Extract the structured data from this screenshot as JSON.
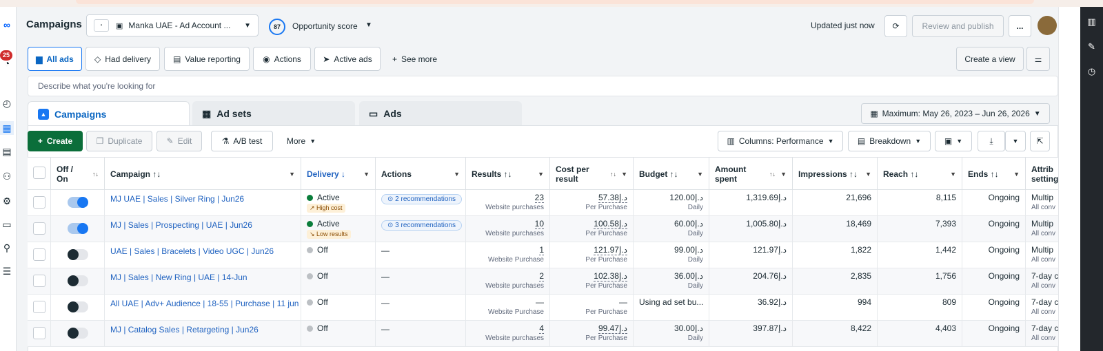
{
  "header": {
    "title": "Campaigns",
    "account": "Manka UAE - Ad Account ...",
    "opportunity_score": "87",
    "opportunity_label": "Opportunity score",
    "updated": "Updated just now",
    "review_publish": "Review and publish",
    "more": "...",
    "notif_count": "25"
  },
  "quickfilters": [
    "All ads",
    "Had delivery",
    "Value reporting",
    "Actions",
    "Active ads",
    "See more"
  ],
  "create_view": "Create a view",
  "filter_placeholder": "Describe what you're looking for",
  "tabs": [
    "Campaigns",
    "Ad sets",
    "Ads"
  ],
  "date_range": "Maximum: May 26, 2023 – Jun 26, 2026",
  "toolbar": {
    "create": "Create",
    "duplicate": "Duplicate",
    "edit": "Edit",
    "ab_test": "A/B test",
    "more": "More",
    "columns": "Columns: Performance",
    "breakdown": "Breakdown"
  },
  "columns": {
    "toggle": "Off / On",
    "campaign": "Campaign ↑↓",
    "delivery": "Delivery ↓",
    "actions": "Actions",
    "results": "Results ↑↓",
    "cost": "Cost per result",
    "cost_sort": "↑↓",
    "budget": "Budget ↑↓",
    "amount": "Amount spent",
    "amount_sort": "↑↓",
    "impressions": "Impressions ↑↓",
    "reach": "Reach ↑↓",
    "ends": "Ends ↑↓",
    "attrib": "Attrib setting"
  },
  "rows": [
    {
      "name": "MJ UAE | Sales | Silver Ring | Jun26",
      "on": true,
      "delivery": "Active",
      "chip": "↗ High cost",
      "action": "⊙ 2 recommendations",
      "results": "23",
      "results_sub": "Website purchases",
      "cost": "د.إ57.38",
      "cost_sub": "Per Purchase",
      "budget": "د.إ120.00",
      "budget_sub": "Daily",
      "amount": "د.إ1,319.69",
      "impressions": "21,696",
      "reach": "8,115",
      "ends": "Ongoing",
      "attrib": "Multip",
      "attrib_sub": "All conv"
    },
    {
      "name": "MJ | Sales | Prospecting | UAE | Jun26",
      "on": true,
      "delivery": "Active",
      "chip": "↘ Low results",
      "action": "⊙ 3 recommendations",
      "results": "10",
      "results_sub": "Website purchases",
      "cost": "د.إ100.58",
      "cost_sub": "Per Purchase",
      "budget": "د.إ60.00",
      "budget_sub": "Daily",
      "amount": "د.إ1,005.80",
      "impressions": "18,469",
      "reach": "7,393",
      "ends": "Ongoing",
      "attrib": "Multip",
      "attrib_sub": "All conv"
    },
    {
      "name": "UAE | Sales | Bracelets | Video UGC | Jun26",
      "on": false,
      "delivery": "Off",
      "chip": "",
      "action": "—",
      "results": "1",
      "results_sub": "Website Purchase",
      "cost": "د.إ121.97",
      "cost_sub": "Per Purchase",
      "budget": "د.إ99.00",
      "budget_sub": "Daily",
      "amount": "د.إ121.97",
      "impressions": "1,822",
      "reach": "1,442",
      "ends": "Ongoing",
      "attrib": "Multip",
      "attrib_sub": "All conv"
    },
    {
      "name": "MJ | Sales | New Ring | UAE | 14-Jun",
      "on": false,
      "delivery": "Off",
      "chip": "",
      "action": "—",
      "results": "2",
      "results_sub": "Website purchases",
      "cost": "د.إ102.38",
      "cost_sub": "Per Purchase",
      "budget": "د.إ36.00",
      "budget_sub": "Daily",
      "amount": "د.إ204.76",
      "impressions": "2,835",
      "reach": "1,756",
      "ends": "Ongoing",
      "attrib": "7-day c",
      "attrib_sub": "All conv"
    },
    {
      "name": "All UAE | Adv+ Audience | 18-55 | Purchase | 11 jun",
      "on": false,
      "delivery": "Off",
      "chip": "",
      "action": "—",
      "results": "—",
      "results_sub": "Website Purchase",
      "cost": "—",
      "cost_sub": "Per Purchase",
      "budget": "Using ad set bu...",
      "budget_sub": "",
      "amount": "د.إ36.92",
      "impressions": "994",
      "reach": "809",
      "ends": "Ongoing",
      "attrib": "7-day c",
      "attrib_sub": "All conv"
    },
    {
      "name": "MJ | Catalog Sales | Retargeting | Jun26",
      "on": false,
      "delivery": "Off",
      "chip": "",
      "action": "—",
      "results": "4",
      "results_sub": "Website purchases",
      "cost": "د.إ99.47",
      "cost_sub": "Per Purchase",
      "budget": "د.إ30.00",
      "budget_sub": "Daily",
      "amount": "د.إ397.87",
      "impressions": "8,422",
      "reach": "4,403",
      "ends": "Ongoing",
      "attrib": "7-day c",
      "attrib_sub": "All conv"
    }
  ],
  "colors": {
    "accent": "#1877f2",
    "active_dot": "#0a7d3b",
    "off_dot": "#bcc0c4",
    "dark_bar": "#23272c"
  }
}
